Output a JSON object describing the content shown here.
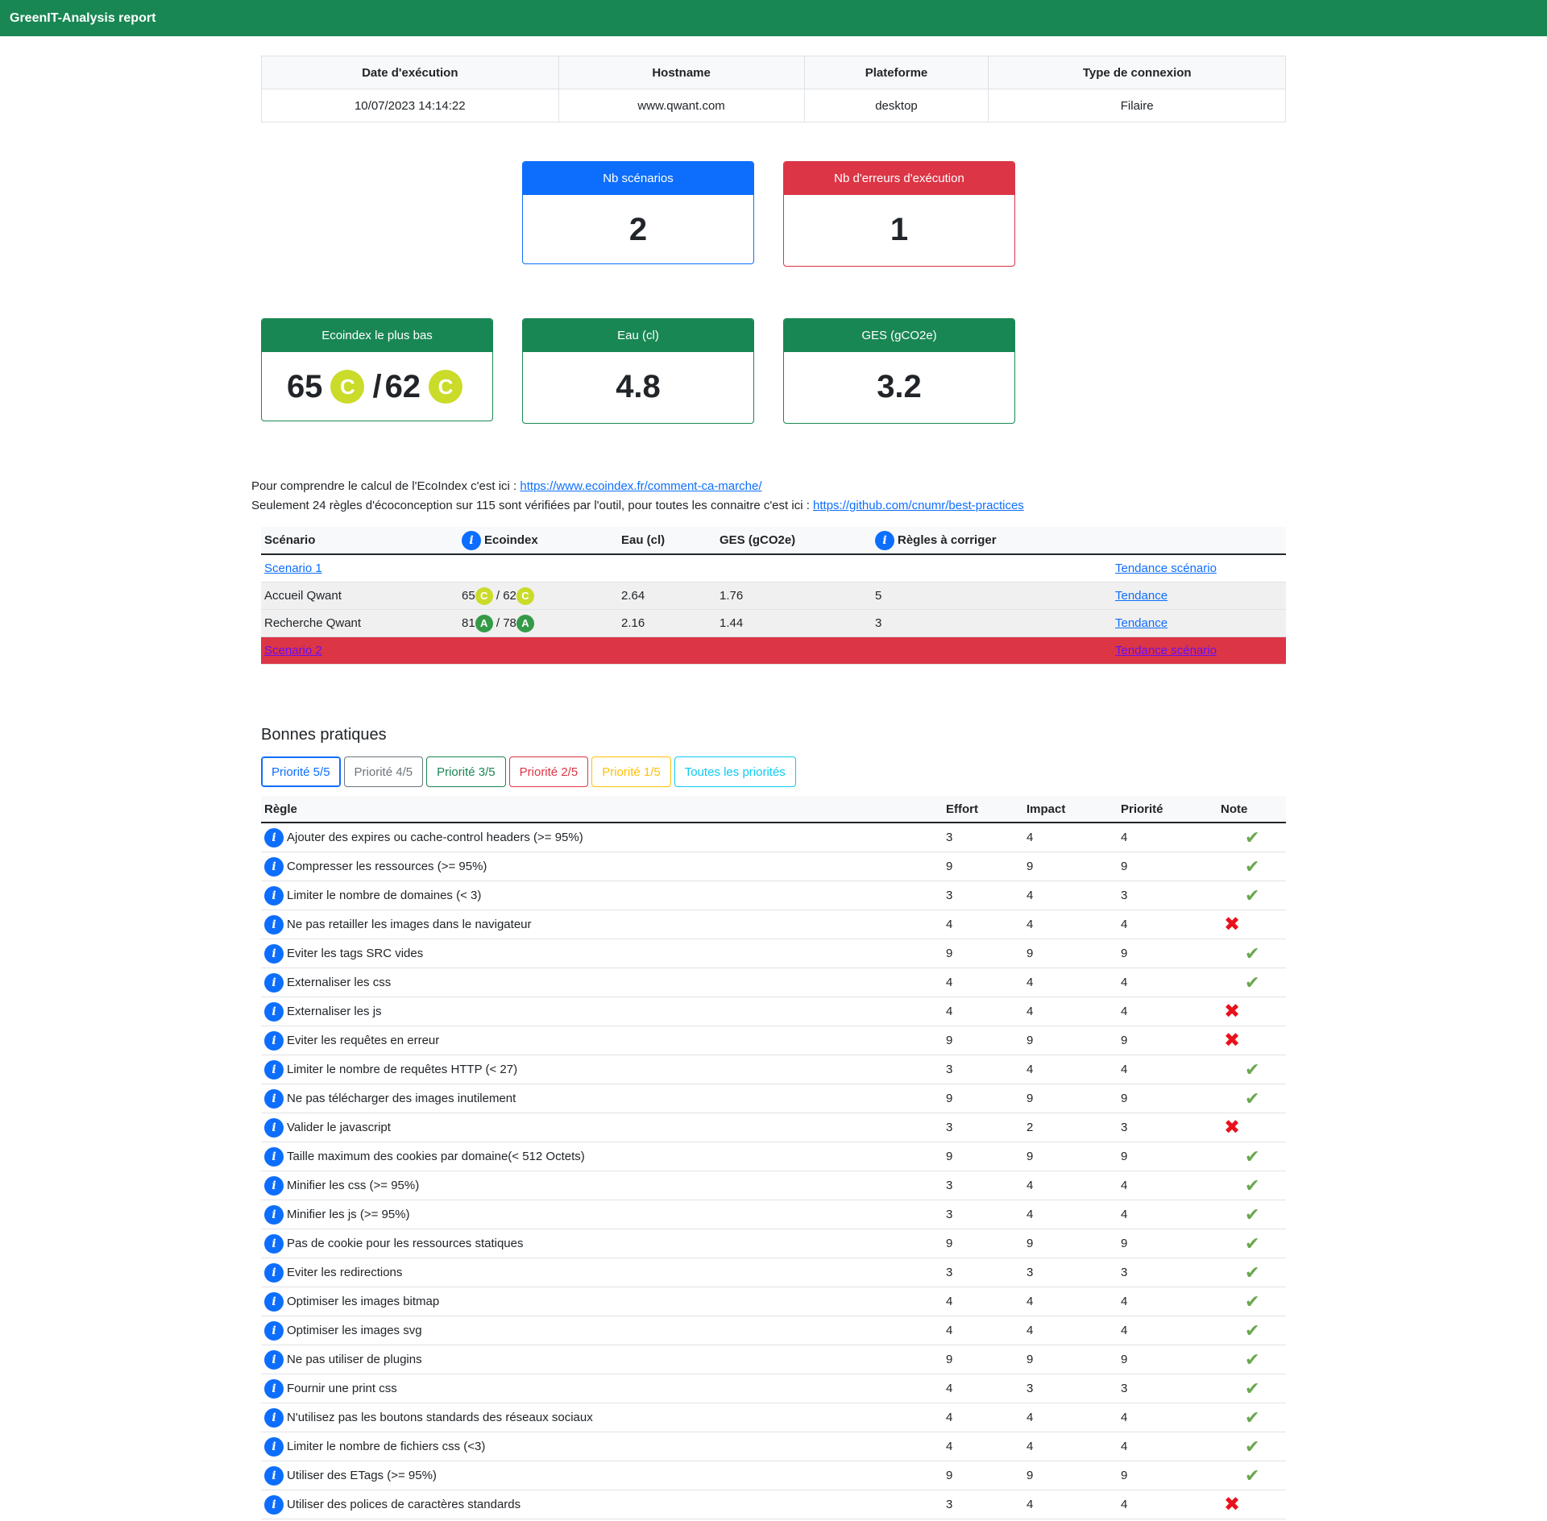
{
  "navbar": {
    "title": "GreenIT-Analysis report"
  },
  "info": {
    "headers": [
      "Date d'exécution",
      "Hostname",
      "Plateforme",
      "Type de connexion"
    ],
    "values": [
      "10/07/2023 14:14:22",
      "www.qwant.com",
      "desktop",
      "Filaire"
    ]
  },
  "cards": {
    "scenarios": {
      "label": "Nb scénarios",
      "value": "2"
    },
    "errors": {
      "label": "Nb d'erreurs d'exécution",
      "value": "1"
    },
    "ecoindex": {
      "label": "Ecoindex le plus bas",
      "value1": "65",
      "grade1": "C",
      "sep": "/",
      "value2": "62",
      "grade2": "C"
    },
    "water": {
      "label": "Eau (cl)",
      "value": "4.8"
    },
    "ges": {
      "label": "GES (gCO2e)",
      "value": "3.2"
    }
  },
  "explain": {
    "line1_text": "Pour comprendre le calcul de l'EcoIndex c'est ici : ",
    "line1_link": "https://www.ecoindex.fr/comment-ca-marche/",
    "line2_text": "Seulement 24 règles d'écoconception sur 115 sont vérifiées par l'outil, pour toutes les connaitre c'est ici : ",
    "line2_link": "https://github.com/cnumr/best-practices"
  },
  "scenario_table": {
    "headers": {
      "scenario": "Scénario",
      "ecoindex": "Ecoindex",
      "eau": "Eau (cl)",
      "ges": "GES (gCO2e)",
      "regles": "Règles à corriger"
    },
    "scenario1": {
      "name": "Scenario 1",
      "tendance": "Tendance scénario"
    },
    "pages": [
      {
        "name": "Accueil Qwant",
        "eco1": "65",
        "g1": "C",
        "eco2": "62",
        "g2": "C",
        "eau": "2.64",
        "ges": "1.76",
        "regles": "5",
        "tendance": "Tendance"
      },
      {
        "name": "Recherche Qwant",
        "eco1": "81",
        "g1": "A",
        "eco2": "78",
        "g2": "A",
        "eau": "2.16",
        "ges": "1.44",
        "regles": "3",
        "tendance": "Tendance"
      }
    ],
    "scenario2": {
      "name": "Scenario 2",
      "tendance": "Tendance scénario"
    }
  },
  "bonnes_pratiques": {
    "title": "Bonnes pratiques",
    "buttons": [
      {
        "label": "Priorité 5/5",
        "color": "#0d6efd"
      },
      {
        "label": "Priorité 4/5",
        "color": "#6c757d"
      },
      {
        "label": "Priorité 3/5",
        "color": "#198754"
      },
      {
        "label": "Priorité 2/5",
        "color": "#dc3545"
      },
      {
        "label": "Priorité 1/5",
        "color": "#ffc107"
      },
      {
        "label": "Toutes les priorités",
        "color": "#0dcaf0"
      }
    ],
    "headers": {
      "regle": "Règle",
      "effort": "Effort",
      "impact": "Impact",
      "priorite": "Priorité",
      "note": "Note"
    },
    "rules": [
      {
        "name": "Ajouter des expires ou cache-control headers (>= 95%)",
        "effort": "3",
        "impact": "4",
        "priorite": "4",
        "ok": true
      },
      {
        "name": "Compresser les ressources (>= 95%)",
        "effort": "9",
        "impact": "9",
        "priorite": "9",
        "ok": true
      },
      {
        "name": "Limiter le nombre de domaines (< 3)",
        "effort": "3",
        "impact": "4",
        "priorite": "3",
        "ok": true
      },
      {
        "name": "Ne pas retailler les images dans le navigateur",
        "effort": "4",
        "impact": "4",
        "priorite": "4",
        "ok": false
      },
      {
        "name": "Eviter les tags SRC vides",
        "effort": "9",
        "impact": "9",
        "priorite": "9",
        "ok": true
      },
      {
        "name": "Externaliser les css",
        "effort": "4",
        "impact": "4",
        "priorite": "4",
        "ok": true
      },
      {
        "name": "Externaliser les js",
        "effort": "4",
        "impact": "4",
        "priorite": "4",
        "ok": false
      },
      {
        "name": "Eviter les requêtes en erreur",
        "effort": "9",
        "impact": "9",
        "priorite": "9",
        "ok": false
      },
      {
        "name": "Limiter le nombre de requêtes HTTP (< 27)",
        "effort": "3",
        "impact": "4",
        "priorite": "4",
        "ok": true
      },
      {
        "name": "Ne pas télécharger des images inutilement",
        "effort": "9",
        "impact": "9",
        "priorite": "9",
        "ok": true
      },
      {
        "name": "Valider le javascript",
        "effort": "3",
        "impact": "2",
        "priorite": "3",
        "ok": false
      },
      {
        "name": "Taille maximum des cookies par domaine(< 512 Octets)",
        "effort": "9",
        "impact": "9",
        "priorite": "9",
        "ok": true
      },
      {
        "name": "Minifier les css (>= 95%)",
        "effort": "3",
        "impact": "4",
        "priorite": "4",
        "ok": true
      },
      {
        "name": "Minifier les js (>= 95%)",
        "effort": "3",
        "impact": "4",
        "priorite": "4",
        "ok": true
      },
      {
        "name": "Pas de cookie pour les ressources statiques",
        "effort": "9",
        "impact": "9",
        "priorite": "9",
        "ok": true
      },
      {
        "name": "Eviter les redirections",
        "effort": "3",
        "impact": "3",
        "priorite": "3",
        "ok": true
      },
      {
        "name": "Optimiser les images bitmap",
        "effort": "4",
        "impact": "4",
        "priorite": "4",
        "ok": true
      },
      {
        "name": "Optimiser les images svg",
        "effort": "4",
        "impact": "4",
        "priorite": "4",
        "ok": true
      },
      {
        "name": "Ne pas utiliser de plugins",
        "effort": "9",
        "impact": "9",
        "priorite": "9",
        "ok": true
      },
      {
        "name": "Fournir une print css",
        "effort": "4",
        "impact": "3",
        "priorite": "3",
        "ok": true
      },
      {
        "name": "N'utilisez pas les boutons standards des réseaux sociaux",
        "effort": "4",
        "impact": "4",
        "priorite": "4",
        "ok": true
      },
      {
        "name": "Limiter le nombre de fichiers css (<3)",
        "effort": "4",
        "impact": "4",
        "priorite": "4",
        "ok": true
      },
      {
        "name": "Utiliser des ETags (>= 95%)",
        "effort": "9",
        "impact": "9",
        "priorite": "9",
        "ok": true
      },
      {
        "name": "Utiliser des polices de caractères standards",
        "effort": "3",
        "impact": "4",
        "priorite": "4",
        "ok": false
      }
    ]
  },
  "icons": {
    "info": "info-icon",
    "ok": "check-icon",
    "ko": "cross-icon"
  }
}
